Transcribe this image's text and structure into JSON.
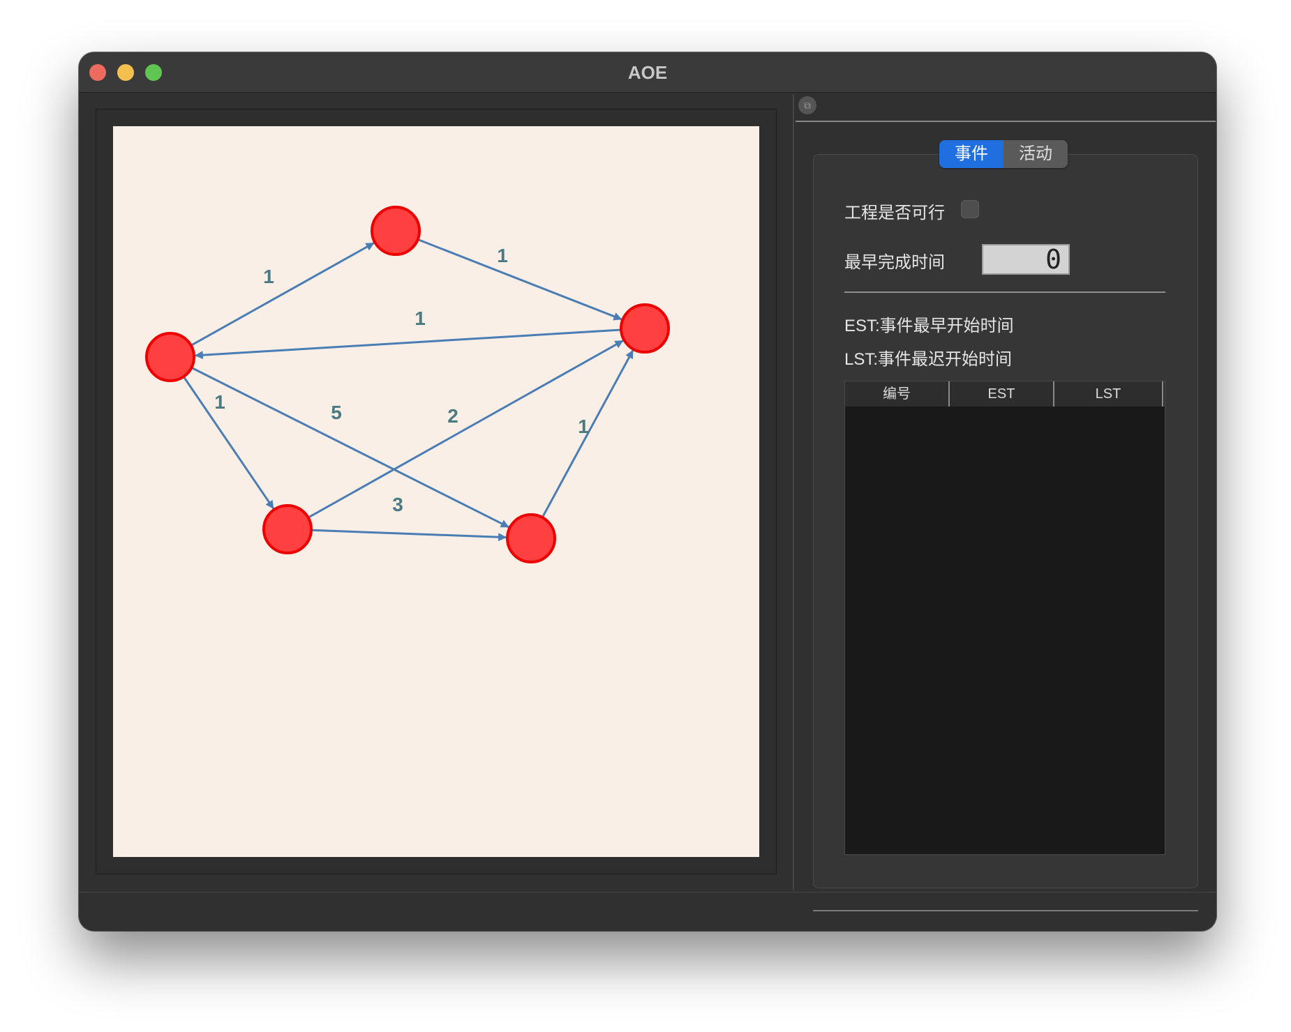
{
  "window": {
    "title": "AOE"
  },
  "graph": {
    "colors": {
      "node_fill": "#ff4040",
      "node_stroke": "#ee0000",
      "edge": "#4a7db3",
      "weight_text": "#4a7b82",
      "background": "#faefe6"
    },
    "edges": [
      {
        "weight": "1"
      },
      {
        "weight": "1"
      },
      {
        "weight": "1"
      },
      {
        "weight": "1"
      },
      {
        "weight": "5"
      },
      {
        "weight": "2"
      },
      {
        "weight": "3"
      },
      {
        "weight": "1"
      }
    ]
  },
  "panel": {
    "tabs": [
      {
        "label": "事件",
        "active": true
      },
      {
        "label": "活动",
        "active": false
      }
    ],
    "feasible_label": "工程是否可行",
    "feasible_checked": false,
    "earliest_finish_label": "最早完成时间",
    "earliest_finish_value": "0",
    "est_desc": "EST:事件最早开始时间",
    "lst_desc": "LST:事件最迟开始时间",
    "table": {
      "columns": [
        "编号",
        "EST",
        "LST"
      ],
      "rows": []
    }
  }
}
